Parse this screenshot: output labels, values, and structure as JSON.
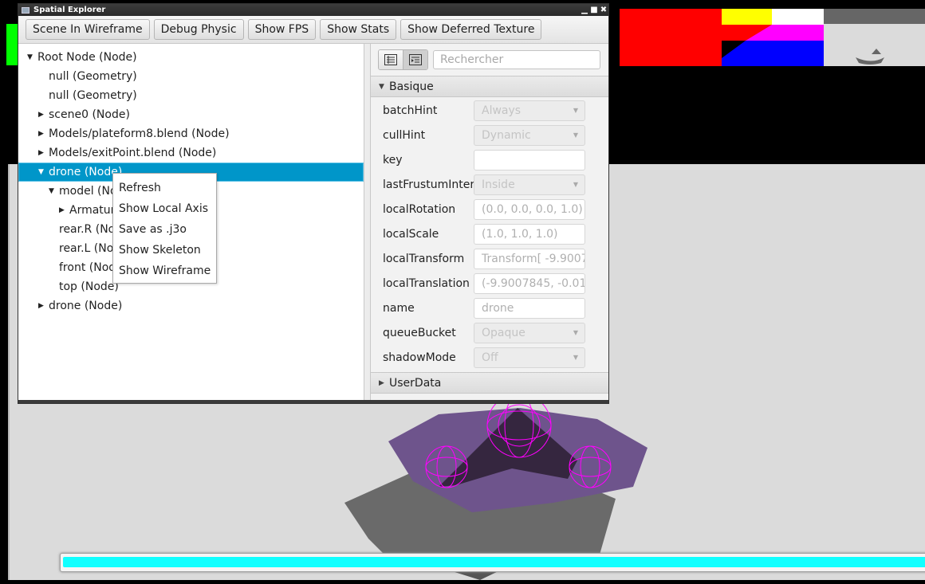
{
  "window": {
    "title": "Spatial Explorer",
    "controls": {
      "minimize": "▁",
      "maximize": "■",
      "close": "✖"
    }
  },
  "toolbar": {
    "buttons": [
      {
        "label": "Scene In Wireframe"
      },
      {
        "label": "Debug Physic"
      },
      {
        "label": "Show FPS"
      },
      {
        "label": "Show Stats"
      },
      {
        "label": "Show Deferred Texture"
      }
    ]
  },
  "tree": {
    "rows": [
      {
        "label": "Root Node (Node)",
        "expander": "▼"
      },
      {
        "label": "null (Geometry)",
        "expander": ""
      },
      {
        "label": "null (Geometry)",
        "expander": ""
      },
      {
        "label": "scene0 (Node)",
        "expander": "▶"
      },
      {
        "label": "Models/plateform8.blend (Node)",
        "expander": "▶"
      },
      {
        "label": "Models/exitPoint.blend (Node)",
        "expander": "▶"
      },
      {
        "label": "drone (Node)",
        "expander": "▼",
        "selected": true
      },
      {
        "label": "model (Node)",
        "expander": "▼"
      },
      {
        "label": "Armature (Node)",
        "expander": "▶"
      },
      {
        "label": "rear.R (Node)",
        "expander": ""
      },
      {
        "label": "rear.L (Node)",
        "expander": ""
      },
      {
        "label": "front (Node)",
        "expander": ""
      },
      {
        "label": "top (Node)",
        "expander": ""
      },
      {
        "label": "drone (Node)",
        "expander": "▶"
      }
    ]
  },
  "context_menu": {
    "items": [
      {
        "label": "Refresh"
      },
      {
        "label": "Show Local Axis"
      },
      {
        "label": "Save as .j3o"
      },
      {
        "label": "Show Skeleton"
      },
      {
        "label": "Show Wireframe"
      }
    ]
  },
  "properties": {
    "search_placeholder": "Rechercher",
    "view_modes": [
      "categorized-icon",
      "alphabetical-icon"
    ],
    "sections": [
      {
        "title": "Basique",
        "expanded": true,
        "expander": "▼"
      },
      {
        "title": "UserData",
        "expanded": false,
        "expander": "▶"
      }
    ],
    "rows": [
      {
        "label": "batchHint",
        "value": "Always",
        "type": "combo"
      },
      {
        "label": "cullHint",
        "value": "Dynamic",
        "type": "combo"
      },
      {
        "label": "key",
        "value": "",
        "type": "text"
      },
      {
        "label": "lastFrustumInter...",
        "value": "Inside",
        "type": "combo"
      },
      {
        "label": "localRotation",
        "value": "(0.0, 0.0, 0.0, 1.0)",
        "type": "text"
      },
      {
        "label": "localScale",
        "value": "(1.0, 1.0, 1.0)",
        "type": "text"
      },
      {
        "label": "localTransform",
        "value": "Transform[ -9.9007",
        "type": "text"
      },
      {
        "label": "localTranslation",
        "value": "(-9.9007845, -0.01",
        "type": "text"
      },
      {
        "label": "name",
        "value": "drone",
        "type": "text"
      },
      {
        "label": "queueBucket",
        "value": "Opaque",
        "type": "combo"
      },
      {
        "label": "shadowMode",
        "value": "Off",
        "type": "combo"
      }
    ]
  },
  "viewport": {
    "progress_fraction": 1.0,
    "colors": {
      "background": "#dbdbdb",
      "progress": "#10ffff",
      "platform": "#6e548c",
      "wireframe": "#ff00ff",
      "shadow": "#6a6a6a",
      "fps_bar": "#00ff00",
      "selection": "#0096c9"
    }
  }
}
